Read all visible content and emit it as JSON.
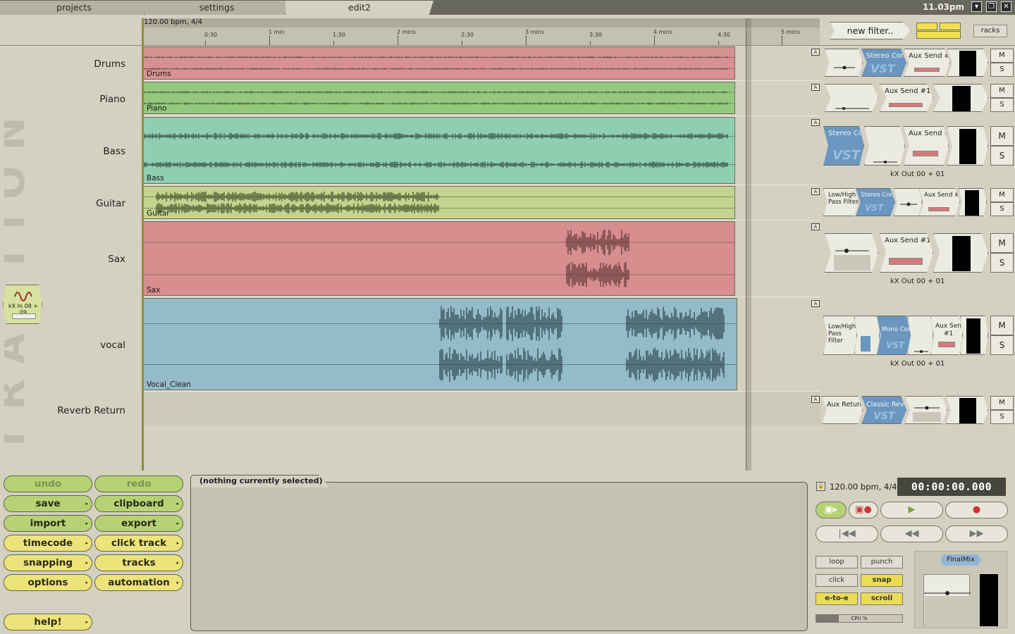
{
  "tabs": [
    {
      "label": "projects"
    },
    {
      "label": "settings"
    },
    {
      "label": "edit2"
    }
  ],
  "clock": "11.03pm",
  "ruler": {
    "tempo": "120.00 bpm, 4/4",
    "labels": [
      "0:30",
      "1 min",
      "1:30",
      "2 mins",
      "2:30",
      "3 mins",
      "3:30",
      "4 mins",
      "4:30",
      "5 mins"
    ]
  },
  "logo_text": "TRAKTION",
  "input_device": {
    "label": "kX In 08 + 09"
  },
  "tracks": [
    {
      "name": "Drums",
      "clip": "Drums",
      "color": "#d89191",
      "wave": "#584848"
    },
    {
      "name": "Piano",
      "clip": "Piano",
      "color": "#94c87e",
      "wave": "#3e5a34"
    },
    {
      "name": "Bass",
      "clip": "Bass",
      "color": "#90ceb2",
      "wave": "#2e4a3e"
    },
    {
      "name": "Guitar",
      "clip": "Guitar",
      "color": "#c4d48e",
      "wave": "#3c4a28"
    },
    {
      "name": "Sax",
      "clip": "Sax",
      "color": "#d68e8e",
      "wave": "#5e3434"
    },
    {
      "name": "vocal",
      "clip": "Vocal_Clean",
      "color": "#94bcc8",
      "wave": "#28404a"
    },
    {
      "name": "Reverb Return",
      "clip": "",
      "color": "",
      "wave": ""
    }
  ],
  "auto_badge": "A",
  "rack": {
    "new_filter": "new filter..",
    "racks": "racks",
    "mute": "M",
    "solo": "S",
    "plugins": {
      "stereo_comp": "Stereo Comp",
      "aux_send": "Aux Send #1",
      "aux_send_short": "Aux Send",
      "aux_send_num": "#1",
      "low_high_pass": "Low/High-Pass Filter",
      "mono_comp": "Mono Comp",
      "aux_return": "Aux Return #",
      "classic_reverb": "Classic Reverb",
      "vst": "VST"
    },
    "output": "kX Out 00 + 01"
  },
  "left_buttons": [
    {
      "label": "undo",
      "style": "dim"
    },
    {
      "label": "redo",
      "style": "dim"
    },
    {
      "label": "save",
      "style": "green"
    },
    {
      "label": "clipboard",
      "style": "green"
    },
    {
      "label": "import",
      "style": "green"
    },
    {
      "label": "export",
      "style": "green"
    },
    {
      "label": "timecode",
      "style": "yel"
    },
    {
      "label": "click track",
      "style": "yel"
    },
    {
      "label": "snapping",
      "style": "yel"
    },
    {
      "label": "tracks",
      "style": "yel"
    },
    {
      "label": "options",
      "style": "yel"
    },
    {
      "label": "automation",
      "style": "yel"
    },
    {
      "label": "help!",
      "style": "yel"
    }
  ],
  "properties": {
    "title": "(nothing currently selected)"
  },
  "transport": {
    "tempo": "120.00 bpm, 4/4",
    "time": "00:00:00.000",
    "loop": "loop",
    "punch": "punch",
    "click": "click",
    "snap": "snap",
    "e_to_e": "e-to-e",
    "scroll": "scroll",
    "cpu": "CPU %",
    "cpu_value": 0.26,
    "final_mix": "FinalMix"
  }
}
